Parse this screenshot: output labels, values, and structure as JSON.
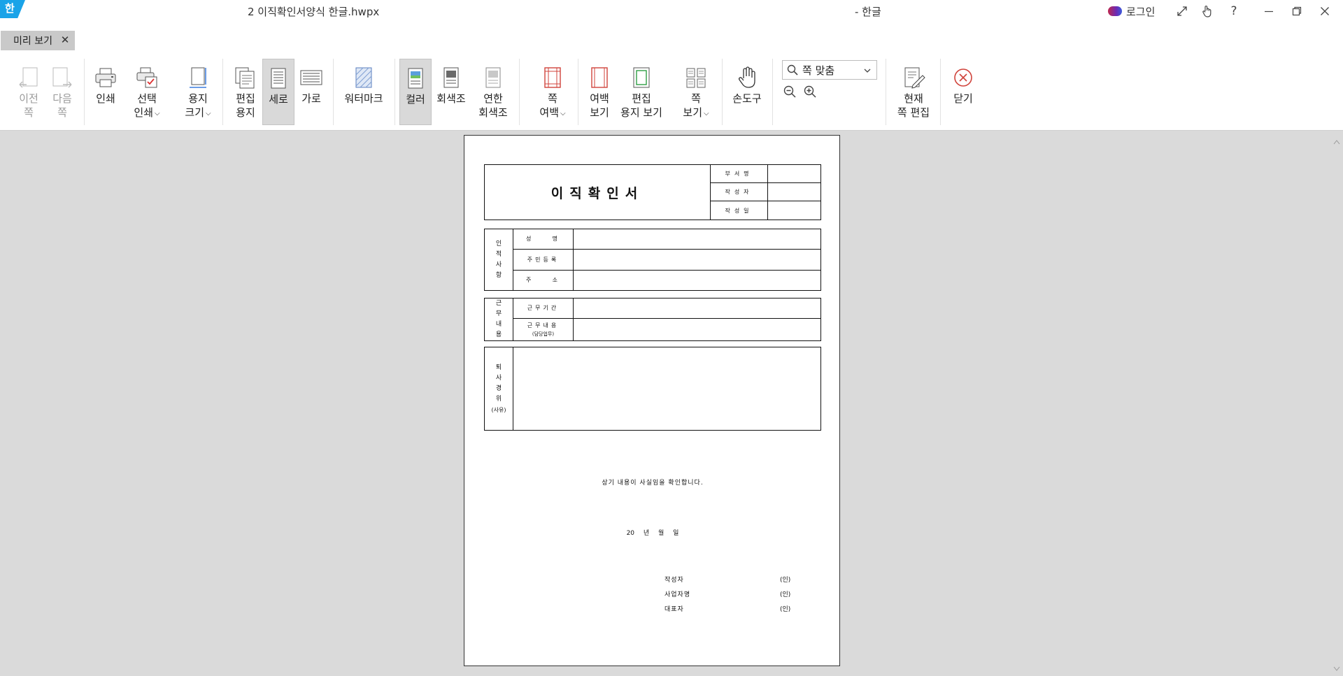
{
  "titlebar": {
    "logo": "한",
    "doc_title": "2 이직확인서양식 한글.hwpx",
    "app_name": "- 한글",
    "login_label": "로그인",
    "controls": [
      "expand-icon",
      "touch-icon",
      "help-icon",
      "minimize-icon",
      "restore-icon",
      "close-icon"
    ],
    "help_glyph": "?"
  },
  "tab": {
    "label": "미리 보기",
    "close_glyph": "✕"
  },
  "ribbon": {
    "prev_page": "이전\n쪽",
    "next_page": "다음\n쪽",
    "print": "인쇄",
    "select_print": "선택\n인쇄",
    "paper_size": "용지\n크기",
    "edit_paper": "편집\n용지",
    "portrait": "세로",
    "landscape": "가로",
    "watermark": "워터마크",
    "color": "컬러",
    "grayscale": "회색조",
    "light_grayscale": "연한\n회색조",
    "page_margin": "쪽\n여백",
    "margin_view": "여백\n보기",
    "edit_paper_view": "편집\n용지 보기",
    "page_view": "쪽\n보기",
    "hand_tool": "손도구",
    "zoom_value": "쪽 맞춤",
    "edit_current_page": "현재\n쪽 편집",
    "close": "닫기",
    "chevron": "⌵"
  },
  "document": {
    "title": "이직확인서",
    "approval": [
      "부서명",
      "작성자",
      "작성일"
    ],
    "personal": {
      "section": [
        "인",
        "적",
        "사",
        "항"
      ],
      "rows": [
        "성    명",
        "주민등록",
        "주    소"
      ]
    },
    "work": {
      "section": [
        "근",
        "무",
        "내",
        "용"
      ],
      "rows": [
        "근무기간",
        "근무내용"
      ],
      "sub": "(담당업무)"
    },
    "reason": {
      "section": [
        "퇴",
        "사",
        "경",
        "위",
        "(사유)"
      ]
    },
    "confirm_text": "상기 내용이 사실임을 확인합니다.",
    "date_text": "20 년 월 일",
    "signatures": [
      {
        "label": "작성자",
        "seal": "(인)"
      },
      {
        "label": "사업자명",
        "seal": "(인)"
      },
      {
        "label": "대표자",
        "seal": "(인)"
      }
    ]
  }
}
